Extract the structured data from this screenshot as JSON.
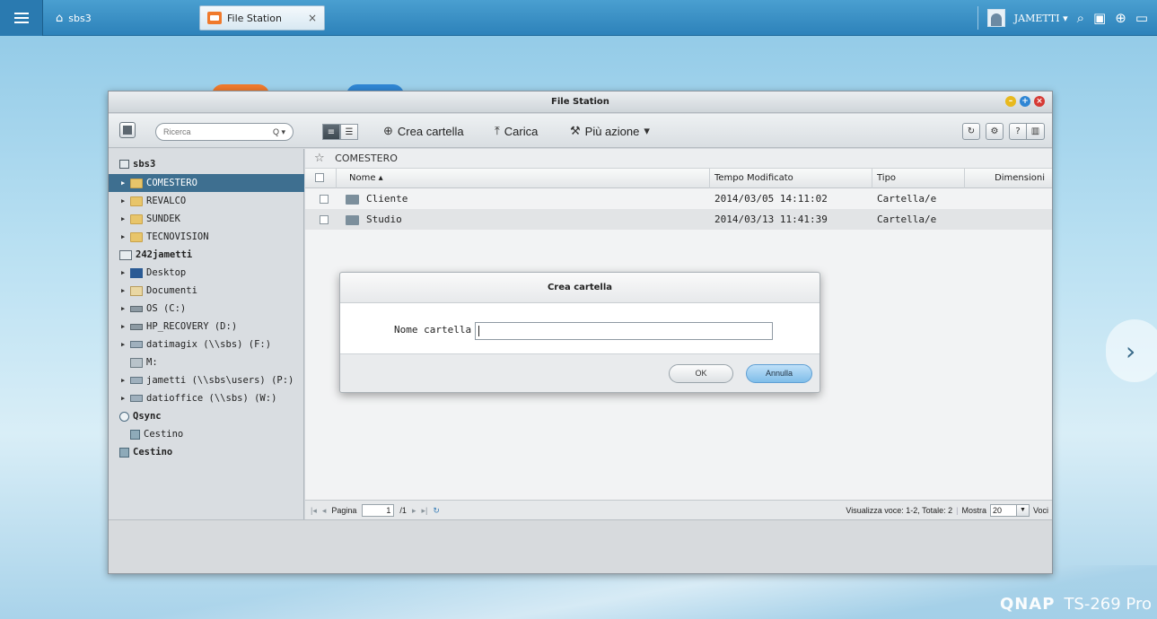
{
  "taskbar": {
    "home_label": "sbs3",
    "app_tab_label": "File Station",
    "close_glyph": "×",
    "username": "JAMETTI",
    "user_caret": "▾"
  },
  "window": {
    "title": "File Station"
  },
  "toolbar": {
    "search_placeholder": "Ricerca",
    "search_glyph": "Q ▾",
    "create_folder": "Crea cartella",
    "upload": "Carica",
    "more_actions": "Più azione"
  },
  "sidebar": {
    "items": [
      {
        "label": "sbs3"
      },
      {
        "label": "COMESTERO"
      },
      {
        "label": "REVALCO"
      },
      {
        "label": "SUNDEK"
      },
      {
        "label": "TECNOVISION"
      },
      {
        "label": "242jametti"
      },
      {
        "label": "Desktop"
      },
      {
        "label": "Documenti"
      },
      {
        "label": "OS (C:)"
      },
      {
        "label": "HP_RECOVERY (D:)"
      },
      {
        "label": "datimagix (\\\\sbs) (F:)"
      },
      {
        "label": "M:"
      },
      {
        "label": "jametti (\\\\sbs\\users) (P:)"
      },
      {
        "label": "datioffice (\\\\sbs) (W:)"
      },
      {
        "label": "Qsync"
      },
      {
        "label": "Cestino"
      },
      {
        "label": "Cestino"
      }
    ]
  },
  "breadcrumb": "COMESTERO",
  "table": {
    "headers": {
      "name": "Nome ▴",
      "modified": "Tempo Modificato",
      "type": "Tipo",
      "size": "Dimensioni"
    },
    "rows": [
      {
        "name": "Cliente",
        "modified": "2014/03/05 14:11:02",
        "type": "Cartella/e"
      },
      {
        "name": "Studio",
        "modified": "2014/03/13 11:41:39",
        "type": "Cartella/e"
      }
    ]
  },
  "pager": {
    "page_label": "Pagina",
    "page_value": "1",
    "page_total": "/1",
    "summary": "Visualizza voce: 1-2, Totale: 2",
    "show_label": "Mostra",
    "per_page": "20",
    "items_label": "Voci"
  },
  "dialog": {
    "title": "Crea cartella",
    "field_label": "Nome cartella :",
    "field_value": "",
    "ok_label": "OK",
    "cancel_label": "Annulla"
  },
  "branding": {
    "brand": "QNAP",
    "model": "TS-269 Pro"
  },
  "colors": {
    "accent": "#3e6f90",
    "topbar": "#2d82ba",
    "cancel_button": "#7fbde9"
  }
}
